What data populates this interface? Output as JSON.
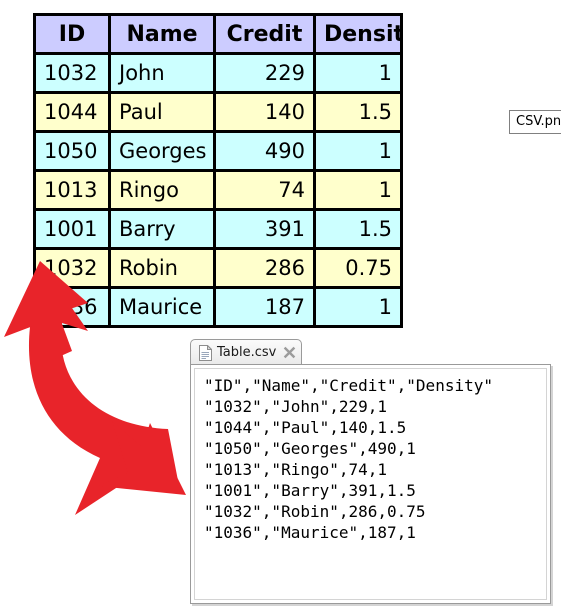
{
  "table": {
    "columns": [
      "ID",
      "Name",
      "Credit",
      "Density"
    ],
    "rows": [
      {
        "id": "1032",
        "name": "John",
        "credit": "229",
        "density": "1"
      },
      {
        "id": "1044",
        "name": "Paul",
        "credit": "140",
        "density": "1.5"
      },
      {
        "id": "1050",
        "name": "Georges",
        "credit": "490",
        "density": "1"
      },
      {
        "id": "1013",
        "name": "Ringo",
        "credit": "74",
        "density": "1"
      },
      {
        "id": "1001",
        "name": "Barry",
        "credit": "391",
        "density": "1.5"
      },
      {
        "id": "1032",
        "name": "Robin",
        "credit": "286",
        "density": "0.75"
      },
      {
        "id": "1036",
        "name": "Maurice",
        "credit": "187",
        "density": "1"
      }
    ],
    "header_color": "#ccccff",
    "row_color_odd": "#ccffff",
    "row_color_even": "#ffffcc",
    "border_color": "#000000"
  },
  "caption": {
    "label": "CSV.png"
  },
  "arrow": {
    "color": "#e8242a",
    "icon": "curved-double-arrow-icon"
  },
  "csv_window": {
    "title": "Table.csv",
    "doc_icon": "document-icon",
    "close_icon": "close-icon",
    "content": "\"ID\",\"Name\",\"Credit\",\"Density\"\n\"1032\",\"John\",229,1\n\"1044\",\"Paul\",140,1.5\n\"1050\",\"Georges\",490,1\n\"1013\",\"Ringo\",74,1\n\"1001\",\"Barry\",391,1.5\n\"1032\",\"Robin\",286,0.75\n\"1036\",\"Maurice\",187,1"
  }
}
